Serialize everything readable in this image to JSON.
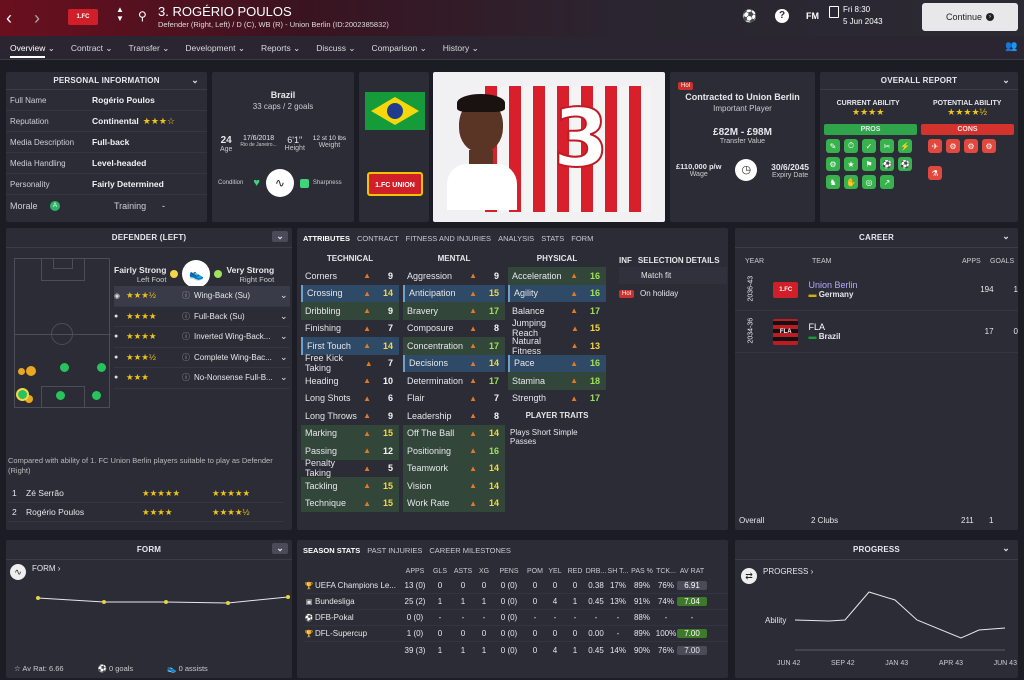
{
  "topbar": {
    "player_name": "3. ROGÉRIO POULOS",
    "player_subtitle": "Defender (Right, Left) / D (C), WB (R) - Union Berlin (ID:2002385832)",
    "fm_label": "FM",
    "date_day": "Fri 8:30",
    "date_full": "5 Jun 2043",
    "continue_label": "Continue"
  },
  "nav": {
    "items": [
      "Overview",
      "Contract",
      "Transfer",
      "Development",
      "Reports",
      "Discuss",
      "Comparison",
      "History"
    ]
  },
  "personal": {
    "title": "PERSONAL INFORMATION",
    "rows": [
      {
        "label": "Full Name",
        "value": "Rogério Poulos"
      },
      {
        "label": "Reputation",
        "value": "Continental"
      },
      {
        "label": "Media Description",
        "value": "Full-back"
      },
      {
        "label": "Media Handling",
        "value": "Level-headed"
      },
      {
        "label": "Personality",
        "value": "Fairly Determined"
      }
    ],
    "reputation_stars": "★★★☆",
    "morale_label": "Morale",
    "morale_badge": "A",
    "training_label": "Training",
    "training_value": "-"
  },
  "bio": {
    "nation": "Brazil",
    "caps": "33 caps / 2 goals",
    "age": "24",
    "age_label": "Age",
    "dob": "17/6/2018",
    "birthplace": "Rio de Janeiro...",
    "height": "6'1\"",
    "height_label": "Height",
    "weight": "12 st 10 lbs",
    "weight_label": "Weight",
    "condition_label": "Condition",
    "sharpness_label": "Sharpness"
  },
  "contract": {
    "hol": "Hol",
    "title": "Contracted to Union Berlin",
    "status": "Important Player",
    "value": "£82M - £98M",
    "value_label": "Transfer Value",
    "wage": "£110,000 p/w",
    "wage_label": "Wage",
    "expiry": "30/6/2045",
    "expiry_label": "Expiry Date"
  },
  "report": {
    "title": "OVERALL REPORT",
    "current_label": "CURRENT ABILITY",
    "potential_label": "POTENTIAL ABILITY",
    "current_stars": "★★★★",
    "potential_stars": "★★★★½",
    "pros_label": "PROS",
    "cons_label": "CONS"
  },
  "position": {
    "title": "DEFENDER (LEFT)",
    "left_foot_rating": "Fairly Strong",
    "left_foot_label": "Left Foot",
    "right_foot_rating": "Very Strong",
    "right_foot_label": "Right Foot",
    "roles": [
      {
        "stars": "★★★½",
        "name": "Wing-Back (Su)"
      },
      {
        "stars": "★★★★",
        "name": "Full-Back (Su)"
      },
      {
        "stars": "★★★★",
        "name": "Inverted Wing-Back..."
      },
      {
        "stars": "★★★½",
        "name": "Complete Wing-Bac..."
      },
      {
        "stars": "★★★",
        "name": "No-Nonsense Full-B..."
      }
    ],
    "compare_text": "Compared with ability of 1. FC Union Berlin players suitable to play as Defender (Right)",
    "comparisons": [
      {
        "rank": "1",
        "name": "Zé Serrão",
        "ca": "★★★★★",
        "pa": "★★★★★"
      },
      {
        "rank": "2",
        "name": "Rogério Poulos",
        "ca": "★★★★",
        "pa": "★★★★½"
      }
    ]
  },
  "attributes": {
    "tabs": [
      "ATTRIBUTES",
      "CONTRACT",
      "FITNESS AND INJURIES",
      "ANALYSIS",
      "STATS",
      "FORM"
    ],
    "technical_title": "TECHNICAL",
    "mental_title": "MENTAL",
    "physical_title": "PHYSICAL",
    "technical": [
      {
        "n": "Corners",
        "v": "9"
      },
      {
        "n": "Crossing",
        "v": "14"
      },
      {
        "n": "Dribbling",
        "v": "9"
      },
      {
        "n": "Finishing",
        "v": "7"
      },
      {
        "n": "First Touch",
        "v": "14"
      },
      {
        "n": "Free Kick Taking",
        "v": "7"
      },
      {
        "n": "Heading",
        "v": "10"
      },
      {
        "n": "Long Shots",
        "v": "6"
      },
      {
        "n": "Long Throws",
        "v": "9"
      },
      {
        "n": "Marking",
        "v": "15"
      },
      {
        "n": "Passing",
        "v": "12"
      },
      {
        "n": "Penalty Taking",
        "v": "5"
      },
      {
        "n": "Tackling",
        "v": "15"
      },
      {
        "n": "Technique",
        "v": "15"
      }
    ],
    "mental": [
      {
        "n": "Aggression",
        "v": "9"
      },
      {
        "n": "Anticipation",
        "v": "15"
      },
      {
        "n": "Bravery",
        "v": "17"
      },
      {
        "n": "Composure",
        "v": "8"
      },
      {
        "n": "Concentration",
        "v": "17"
      },
      {
        "n": "Decisions",
        "v": "14"
      },
      {
        "n": "Determination",
        "v": "17"
      },
      {
        "n": "Flair",
        "v": "7"
      },
      {
        "n": "Leadership",
        "v": "8"
      },
      {
        "n": "Off The Ball",
        "v": "14"
      },
      {
        "n": "Positioning",
        "v": "16"
      },
      {
        "n": "Teamwork",
        "v": "14"
      },
      {
        "n": "Vision",
        "v": "14"
      },
      {
        "n": "Work Rate",
        "v": "14"
      }
    ],
    "physical": [
      {
        "n": "Acceleration",
        "v": "16"
      },
      {
        "n": "Agility",
        "v": "16"
      },
      {
        "n": "Balance",
        "v": "17"
      },
      {
        "n": "Jumping Reach",
        "v": "15"
      },
      {
        "n": "Natural Fitness",
        "v": "13"
      },
      {
        "n": "Pace",
        "v": "16"
      },
      {
        "n": "Stamina",
        "v": "18"
      },
      {
        "n": "Strength",
        "v": "17"
      }
    ],
    "player_traits_title": "PLAYER TRAITS",
    "player_traits": "Plays Short Simple Passes",
    "inf_label": "INF",
    "selection_title": "SELECTION DETAILS",
    "selection": [
      "Match fit",
      "On holiday"
    ],
    "hol": "Hol"
  },
  "career": {
    "title": "CAREER",
    "col_year": "YEAR",
    "col_team": "TEAM",
    "col_apps": "APPS",
    "col_goals": "GOALS",
    "rows": [
      {
        "year": "2036-43",
        "team": "Union Berlin",
        "country": "Germany",
        "apps": "194",
        "goals": "1"
      },
      {
        "year": "2034-36",
        "team": "FLA",
        "country": "Brazil",
        "apps": "17",
        "goals": "0"
      }
    ],
    "overall_label": "Overall",
    "overall_clubs": "2 Clubs",
    "overall_apps": "211",
    "overall_goals": "1"
  },
  "form": {
    "title": "FORM",
    "form_label": "FORM",
    "av_rat": "Av Rat: 6.66",
    "goals": "0 goals",
    "assists": "0 assists"
  },
  "season": {
    "tabs": [
      "SEASON STATS",
      "PAST INJURIES",
      "CAREER MILESTONES"
    ],
    "headers": [
      "APPS",
      "GLS",
      "ASTS",
      "XG",
      "PENS",
      "POM",
      "YEL",
      "RED",
      "DRB...",
      "SH T...",
      "PAS %",
      "TCK...",
      "AV RAT"
    ],
    "rows": [
      {
        "comp": "UEFA Champions Le...",
        "c": [
          "13 (0)",
          "0",
          "0",
          "0",
          "0 (0)",
          "0",
          "0",
          "0",
          "0.38",
          "17%",
          "89%",
          "76%",
          "6.91"
        ]
      },
      {
        "comp": "Bundesliga",
        "c": [
          "25 (2)",
          "1",
          "1",
          "1",
          "0 (0)",
          "0",
          "4",
          "1",
          "0.45",
          "13%",
          "91%",
          "74%",
          "7.04"
        ]
      },
      {
        "comp": "DFB-Pokal",
        "c": [
          "0 (0)",
          "-",
          "-",
          "-",
          "0 (0)",
          "-",
          "-",
          "-",
          "-",
          "-",
          "88%",
          "-",
          "-"
        ]
      },
      {
        "comp": "DFL-Supercup",
        "c": [
          "1 (0)",
          "0",
          "0",
          "0",
          "0 (0)",
          "0",
          "0",
          "0",
          "0.00",
          "-",
          "89%",
          "100%",
          "7.00"
        ]
      }
    ],
    "totals": [
      "39 (3)",
      "1",
      "1",
      "1",
      "0 (0)",
      "0",
      "4",
      "1",
      "0.45",
      "14%",
      "90%",
      "76%",
      "7.00"
    ]
  },
  "progress": {
    "title": "PROGRESS",
    "label": "PROGRESS",
    "ability_label": "Ability",
    "x_labels": [
      "JUN 42",
      "SEP 42",
      "JAN 43",
      "APR 43",
      "JUN 43"
    ]
  }
}
